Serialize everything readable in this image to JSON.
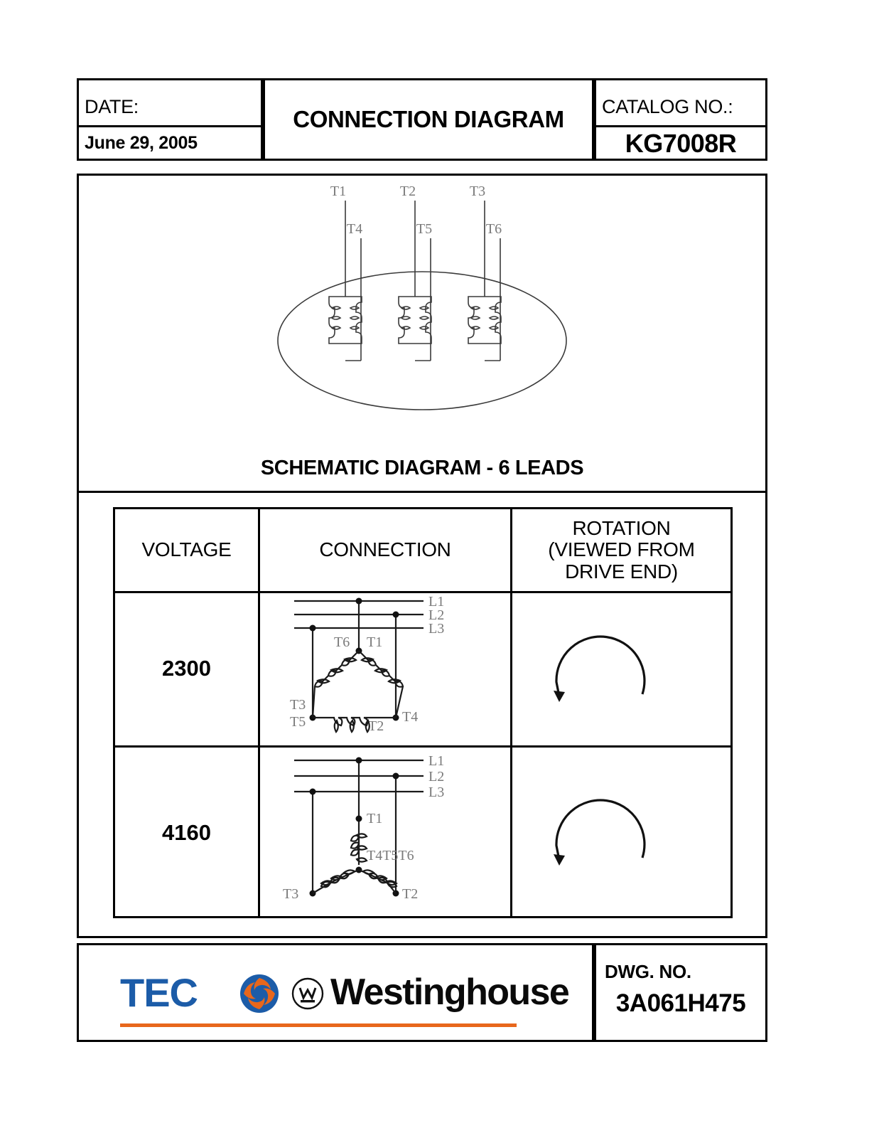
{
  "header": {
    "date_label": "DATE:",
    "date_value": "June 29, 2005",
    "title": "CONNECTION DIAGRAM",
    "catalog_label": "CATALOG NO.:",
    "catalog_value": "KG7008R"
  },
  "schematic": {
    "caption": "SCHEMATIC DIAGRAM - 6 LEADS",
    "top_leads": [
      "T1",
      "T2",
      "T3"
    ],
    "inner_leads": [
      "T4",
      "T5",
      "T6"
    ],
    "winding_count": 3,
    "coil_bumps_per_side": 3,
    "enclosure_shape": "ellipse"
  },
  "table": {
    "headers": {
      "voltage": "VOLTAGE",
      "connection": "CONNECTION",
      "rotation": "ROTATION\n(VIEWED FROM\nDRIVE END)",
      "rotation_line1": "ROTATION",
      "rotation_line2": "(VIEWED FROM",
      "rotation_line3": "DRIVE END)"
    },
    "rows": [
      {
        "voltage": "2300",
        "connection_type": "delta",
        "line_labels": [
          "L1",
          "L2",
          "L3"
        ],
        "terminal_labels": [
          "T6",
          "T1",
          "T3",
          "T5",
          "T4",
          "T2"
        ],
        "rotation": "counterclockwise"
      },
      {
        "voltage": "4160",
        "connection_type": "wye",
        "line_labels": [
          "L1",
          "L2",
          "L3"
        ],
        "terminal_labels": [
          "T1",
          "T4T5T6",
          "T3",
          "T2"
        ],
        "rotation": "counterclockwise"
      }
    ]
  },
  "footer": {
    "brand_teco": "TEC",
    "brand_westinghouse": "Westinghouse",
    "dwg_label": "DWG. NO.",
    "dwg_value": "3A061H475"
  },
  "colors": {
    "teco_blue": "#1C5CA8",
    "teco_orange": "#E8671C",
    "line": "#000000",
    "schematic_stroke": "#3a3a3a"
  }
}
